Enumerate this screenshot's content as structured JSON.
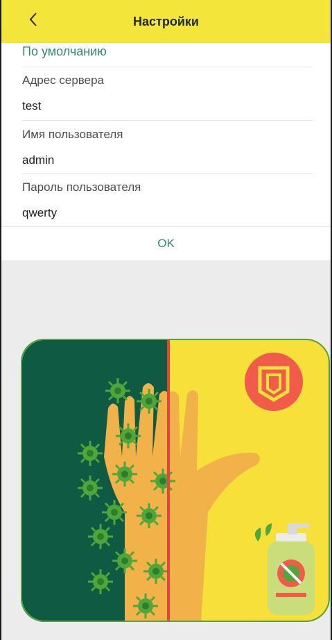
{
  "header": {
    "title": "Настройки",
    "back_icon": "chevron-left-icon"
  },
  "settings": {
    "default_link": "По умолчанию",
    "fields": [
      {
        "label": "Адрес сервера",
        "value": "test"
      },
      {
        "label": "Имя пользователя",
        "value": "admin"
      },
      {
        "label": "Пароль пользователя",
        "value": "qwerty"
      }
    ],
    "ok_label": "OK"
  },
  "colors": {
    "topbar": "#f3e53a",
    "accent_green": "#2f8a6b",
    "illustration_dark_green": "#0f5a42",
    "illustration_yellow": "#f7e03a",
    "hand": "#f2b24a",
    "badge": "#f05b4a"
  }
}
